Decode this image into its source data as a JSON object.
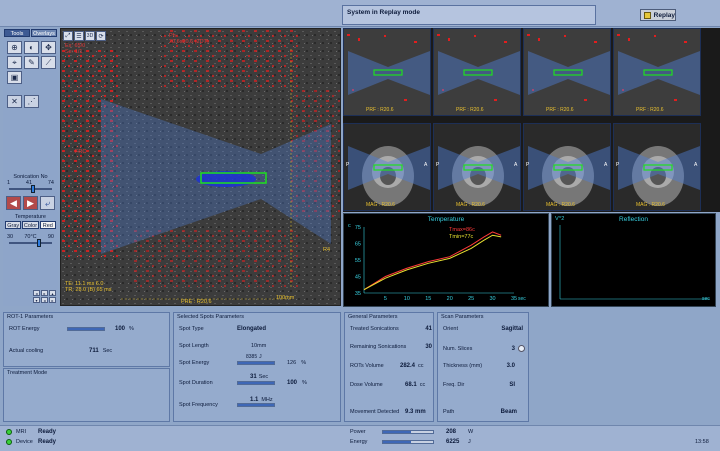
{
  "status": {
    "text": "System in Replay mode"
  },
  "replay": {
    "label": "Replay"
  },
  "tools": {
    "tab_tools": "Tools",
    "tab_overlays": "Overlays"
  },
  "sonication": {
    "label": "Sonication No",
    "min": "1",
    "max": "74",
    "value": "41"
  },
  "temperature": {
    "label": "Temperature",
    "btn_gray": "Gray",
    "btn_color": "Color",
    "btn_red": "Red",
    "min": "30",
    "max": "90",
    "value": "70",
    "unit": "°C"
  },
  "main_image": {
    "top_left": [
      "Ex: 65/0",
      "Se: 1/1"
    ],
    "top_center": [
      "Ph",
      "20.6x20.6 (2DT)"
    ],
    "left_mid": "FRC",
    "bottom_left": [
      "TE: 11.1 ms 6.0",
      "TR: 28.0 (B) 65 ms"
    ],
    "bottom_center": "PRE : R20.6",
    "right_mid": "R4",
    "scale": "100mm"
  },
  "thumb_labels": {
    "top": "PRF : R20.6",
    "bottom": "MAG : R20.6",
    "side_p": "P",
    "side_a": "A"
  },
  "temperature_chart": {
    "title": "Temperature",
    "ylabel": "c",
    "xlabel": "sec",
    "legend": [
      "Tmax=86c",
      "Tmin=77c"
    ]
  },
  "reflection_chart": {
    "title": "Reflection",
    "ylabel": "V^2",
    "xlabel": "sec"
  },
  "chart_data": {
    "type": "line",
    "title": "Temperature",
    "xlabel": "sec",
    "ylabel": "c",
    "x_ticks": [
      5,
      10,
      15,
      20,
      25,
      30,
      35
    ],
    "y_ticks": [
      35,
      45,
      55,
      65,
      75
    ],
    "xlim": [
      0,
      35
    ],
    "ylim": [
      35,
      75
    ],
    "series": [
      {
        "name": "Tmax=86c",
        "color": "#ff3a3a",
        "x": [
          0,
          5,
          10,
          15,
          20,
          25,
          28,
          30,
          32
        ],
        "y": [
          37,
          45,
          50,
          54,
          57,
          64,
          69,
          72,
          70
        ]
      },
      {
        "name": "Tmin=77c",
        "color": "#e8e030",
        "x": [
          0,
          5,
          10,
          15,
          20,
          25,
          28,
          30,
          32
        ],
        "y": [
          37,
          44,
          49,
          53,
          56,
          62,
          67,
          70,
          69
        ]
      }
    ]
  },
  "rot1": {
    "title": "ROT-1 Parameters",
    "energy_label": "ROT Energy",
    "energy_value": "100",
    "energy_unit": "%",
    "cooling_label": "Actual cooling",
    "cooling_value": "711",
    "cooling_unit": "Sec"
  },
  "treatment": {
    "title": "Treatment Mode"
  },
  "spots": {
    "title": "Selected Spots Parameters",
    "type_label": "Spot Type",
    "type_value": "Elongated",
    "length_label": "Spot Length",
    "length_value": "10mm",
    "energy_label": "Spot Energy",
    "energy_value": "8385",
    "energy_unit": "J",
    "energy_pct": "126",
    "pct_unit": "%",
    "duration_label": "Spot Duration",
    "duration_value": "31",
    "duration_unit": "Sec",
    "duration_pct": "100",
    "freq_label": "Spot Frequency",
    "freq_value": "1.1",
    "freq_unit": "MHz"
  },
  "general": {
    "title": "General Parameters",
    "treated_label": "Treated Sonications",
    "treated_value": "41",
    "remaining_label": "Remaining Sonications",
    "remaining_value": "30",
    "rois_label": "ROTs Volume",
    "rois_value": "282.4",
    "rois_unit": "cc",
    "dose_label": "Dose Volume",
    "dose_value": "68.1",
    "dose_unit": "cc",
    "movement_label": "Movement Detected",
    "movement_value": "9.3 mm"
  },
  "scan": {
    "title": "Scan Parameters",
    "orient_label": "Orient",
    "orient_value": "Sagittal",
    "slices_label": "Num. Slices",
    "slices_value": "3",
    "thickness_label": "Thickness (mm)",
    "thickness_value": "3.0",
    "freq_label": "Freq. Dir",
    "freq_value": "SI",
    "path_label": "Path",
    "path_value": "Beam"
  },
  "footer": {
    "mri_label": "MRI",
    "mri_status": "Ready",
    "device_label": "Device",
    "device_status": "Ready",
    "power_label": "Power",
    "power_value": "208",
    "power_unit": "W",
    "power_level": 0.55,
    "energy_label": "Energy",
    "energy_value": "6225",
    "energy_unit": "J",
    "energy_level": 0.55,
    "time": "13:58"
  },
  "colors": {
    "accent": "#3e67b6",
    "panel": "#95abcd",
    "tmax": "#ff3a3a",
    "tmin": "#e8e030",
    "cyan": "#38d0e0",
    "ready": "#3ad13a"
  },
  "icons": [
    "zoom-icon",
    "contrast-icon",
    "pan-icon",
    "measure-icon",
    "pencil-icon",
    "ruler-icon",
    "camera-icon",
    "distance-icon",
    "angle-icon",
    "left-arrow-icon",
    "right-arrow-icon",
    "play-icon"
  ]
}
